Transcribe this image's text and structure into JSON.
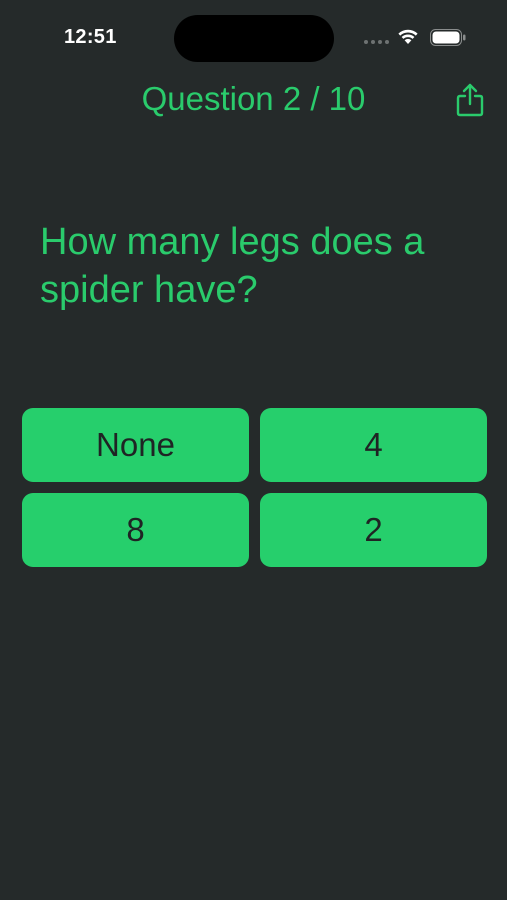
{
  "status_bar": {
    "time": "12:51",
    "icons": [
      "signal-dots-icon",
      "wifi-icon",
      "battery-icon"
    ]
  },
  "nav": {
    "title": "Question 2 / 10",
    "share_icon": "share-icon"
  },
  "question": {
    "text": "How many legs does a spider have?"
  },
  "answers": [
    {
      "label": "None"
    },
    {
      "label": "4"
    },
    {
      "label": "8"
    },
    {
      "label": "2"
    }
  ],
  "colors": {
    "background": "#252a2a",
    "accent": "#2acb6c",
    "button_fill": "#26cf6c",
    "button_text": "#1f2424"
  }
}
